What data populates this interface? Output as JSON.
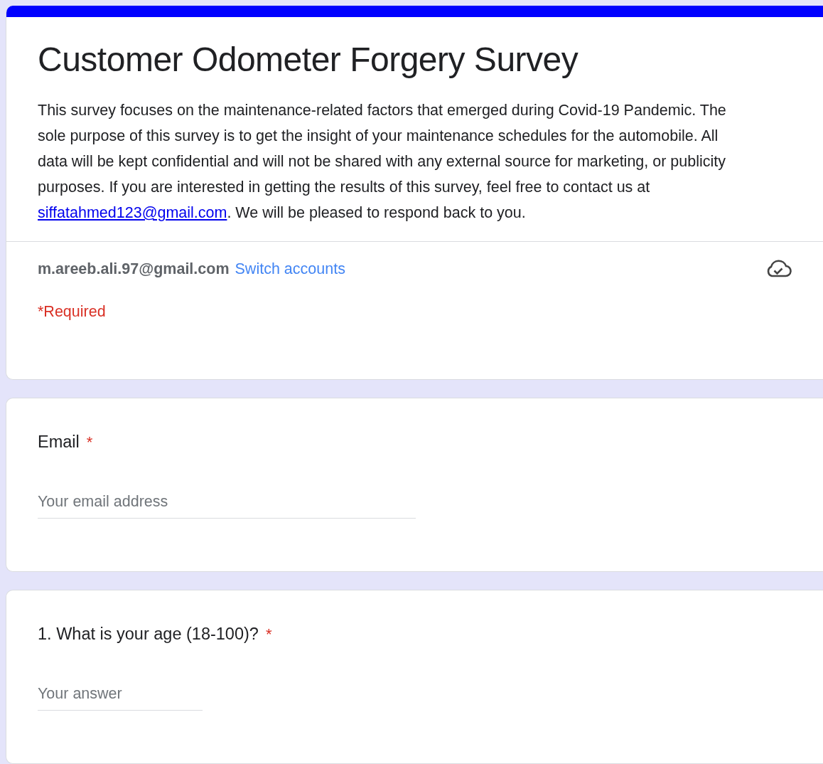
{
  "form": {
    "title": "Customer Odometer Forgery Survey",
    "description": {
      "before": "This survey focuses on the maintenance-related factors that emerged during Covid-19 Pandemic. The sole purpose of this survey is to get the insight of your maintenance schedules for the automobile. All data will be kept confidential and will not be shared with any external source for marketing, or publicity purposes. If you are interested in getting the results of this survey, feel free to contact us at ",
      "link": "siffatahmed123@gmail.com",
      "after": ". We will be pleased to respond back to you."
    },
    "account": {
      "email": "m.areeb.ali.97@gmail.com",
      "switch_link": "Switch accounts"
    },
    "required_note": "*Required"
  },
  "questions": [
    {
      "label": "Email",
      "required_mark": "*",
      "placeholder": "Your email address",
      "kind": "long"
    },
    {
      "label": "1. What is your age (18-100)?",
      "required_mark": "*",
      "placeholder": "Your answer",
      "kind": "short"
    }
  ]
}
